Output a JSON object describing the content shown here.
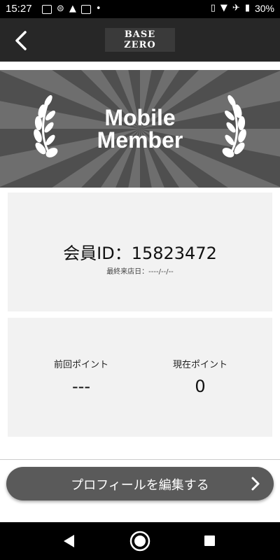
{
  "status_bar": {
    "time": "15:27",
    "battery_percent": "30%",
    "left_icons": [
      "image-icon",
      "recorder-icon",
      "warning-icon",
      "app-icon",
      "dot-icon"
    ],
    "right_icons": [
      "vibrate-icon",
      "wifi-icon",
      "airplane-icon",
      "battery-icon"
    ]
  },
  "header": {
    "logo_line1": "BASE",
    "logo_line2": "ZERO"
  },
  "banner": {
    "title_line1": "Mobile",
    "title_line2": "Member"
  },
  "member": {
    "id_text": "会員ID：15823472",
    "last_visit": "最終来店日：----/--/--"
  },
  "points": {
    "previous_label": "前回ポイント",
    "previous_value": "---",
    "current_label": "現在ポイント",
    "current_value": "0"
  },
  "actions": {
    "edit_profile_label": "プロフィールを編集する"
  },
  "colors": {
    "header_bg": "#272727",
    "banner_bg": "#555555",
    "card_bg": "#f2f2f2",
    "button_bg": "#5a5a5a"
  }
}
